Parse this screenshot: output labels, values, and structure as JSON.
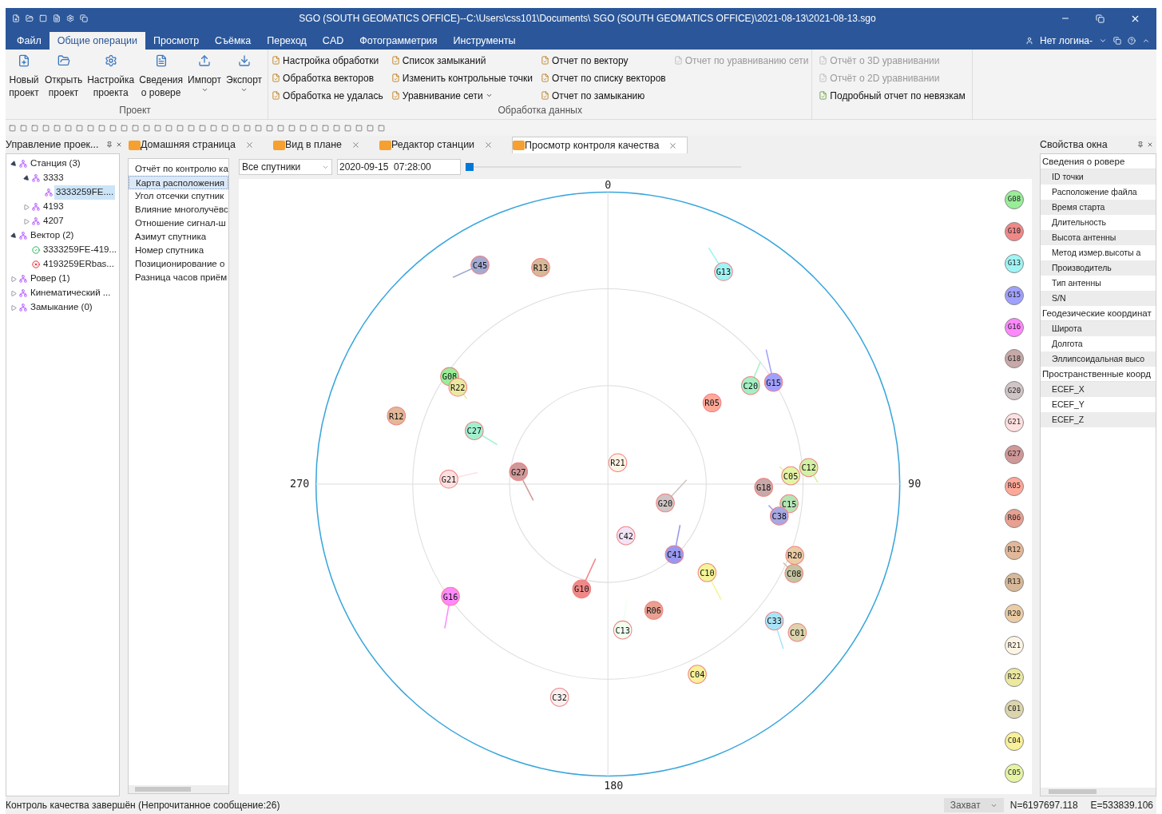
{
  "window": {
    "title": "SGO (SOUTH GEOMATICS OFFICE)--C:\\Users\\css101\\Documents\\ SGO (SOUTH GEOMATICS OFFICE)\\2021-08-13\\2021-08-13.sgo"
  },
  "menu": [
    {
      "label": "Файл",
      "selected": false
    },
    {
      "label": "Общие операции",
      "selected": true
    },
    {
      "label": "Просмотр",
      "selected": false
    },
    {
      "label": "Съёмка",
      "selected": false
    },
    {
      "label": "Переход",
      "selected": false
    },
    {
      "label": "CAD",
      "selected": false
    },
    {
      "label": "Фотограмметрия",
      "selected": false
    },
    {
      "label": "Инструменты",
      "selected": false
    }
  ],
  "user": "Нет логина-",
  "ribbon": {
    "project_group": {
      "caption": "Проект",
      "buttons": [
        {
          "kind": "new",
          "label": "Новый проект",
          "dropdown": false
        },
        {
          "kind": "open",
          "label": "Открыть проект",
          "dropdown": false
        },
        {
          "kind": "settings",
          "label": "Настройка проекта",
          "dropdown": false
        },
        {
          "kind": "info",
          "label": "Сведения о ровере",
          "dropdown": false
        },
        {
          "kind": "import",
          "label": "Импорт",
          "dropdown": true
        },
        {
          "kind": "export",
          "label": "Экспорт",
          "dropdown": true
        }
      ]
    },
    "data_group": {
      "caption": "Обработка данных",
      "columns": [
        [
          {
            "label": "Настройка обработки",
            "disabled": false,
            "dropdown": false
          },
          {
            "label": "Обработка векторов",
            "disabled": false,
            "dropdown": false
          },
          {
            "label": "Обработка не удалась",
            "disabled": false,
            "dropdown": false
          }
        ],
        [
          {
            "label": "Список замыканий",
            "disabled": false,
            "dropdown": false
          },
          {
            "label": "Изменить контрольные точки",
            "disabled": false,
            "dropdown": false
          },
          {
            "label": "Уравнивание сети",
            "disabled": false,
            "dropdown": true
          }
        ],
        [
          {
            "label": "Отчет по вектору",
            "disabled": false,
            "dropdown": false
          },
          {
            "label": "Отчет по списку векторов",
            "disabled": false,
            "dropdown": false
          },
          {
            "label": "Отчет по замыканию",
            "disabled": false,
            "dropdown": false
          }
        ],
        [
          {
            "label": "Отчет по уравниванию сети",
            "disabled": true,
            "dropdown": false
          }
        ]
      ]
    },
    "report_group": {
      "items": [
        {
          "label": "Отчёт о 3D уравнивании",
          "disabled": true
        },
        {
          "label": "Отчёт о 2D уравнивании",
          "disabled": true
        },
        {
          "label": "Подробный отчет по невязкам",
          "disabled": false
        }
      ]
    }
  },
  "left_panel": {
    "title": "Управление проек...",
    "tree": [
      {
        "label": "Станция (3)",
        "selected": false,
        "expanded": true,
        "children": [
          {
            "label": "3333",
            "selected": false,
            "expanded": true,
            "children": [
              {
                "label": "3333259FE....",
                "selected": true
              }
            ]
          },
          {
            "label": "4193",
            "selected": false,
            "expanded": false
          },
          {
            "label": "4207",
            "selected": false,
            "expanded": false
          }
        ]
      },
      {
        "label": "Вектор (2)",
        "selected": false,
        "expanded": true,
        "children": [
          {
            "label": "3333259FE-419...",
            "selected": false,
            "kind": "ok"
          },
          {
            "label": "4193259ERbas...",
            "selected": false,
            "kind": "failed"
          }
        ]
      },
      {
        "label": "Ровер (1)",
        "selected": false,
        "expanded": false
      },
      {
        "label": "Кинематический ...",
        "selected": false,
        "expanded": false
      },
      {
        "label": "Замыкание (0)",
        "selected": false,
        "expanded": false
      }
    ]
  },
  "doc_tabs": [
    {
      "label": "Домашняя страница",
      "selected": false
    },
    {
      "label": "Вид в плане",
      "selected": false
    },
    {
      "label": "Редактор станции",
      "selected": false
    },
    {
      "label": "Просмотр контроля качества",
      "selected": true
    }
  ],
  "qc_list": [
    {
      "label": "Отчёт по контролю ка",
      "selected": false
    },
    {
      "label": "Карта расположения",
      "selected": true
    },
    {
      "label": "Угол отсечки спутник",
      "selected": false
    },
    {
      "label": "Влияние многолучёвс",
      "selected": false
    },
    {
      "label": "Отношение сигнал-ш",
      "selected": false
    },
    {
      "label": "Азимут спутника",
      "selected": false
    },
    {
      "label": "Номер спутника",
      "selected": false
    },
    {
      "label": "Позиционирование о",
      "selected": false
    },
    {
      "label": "Разница часов приём",
      "selected": false
    }
  ],
  "plot": {
    "filter": "Все спутники",
    "time": "2020-09-15  07:28:00",
    "slider": {
      "level": 0
    },
    "axis_labels": [
      "0",
      "90",
      "180",
      "270"
    ],
    "satellites": [
      {
        "label": "C45",
        "color": "#a3aad2"
      },
      {
        "label": "R13",
        "color": "#d8b898"
      },
      {
        "label": "G13",
        "color": "#a0f4f4"
      },
      {
        "label": "G08",
        "color": "#98ee98"
      },
      {
        "label": "R22",
        "color": "#ece8a0"
      },
      {
        "label": "C20",
        "color": "#a4f0c4"
      },
      {
        "label": "G15",
        "color": "#a0a0ff"
      },
      {
        "label": "R05",
        "color": "#ffa898"
      },
      {
        "label": "R12",
        "color": "#e2b898"
      },
      {
        "label": "C27",
        "color": "#a0f0d0"
      },
      {
        "label": "R21",
        "color": "#fff4e4"
      },
      {
        "label": "C12",
        "color": "#d4f0a4"
      },
      {
        "label": "G27",
        "color": "#d09898"
      },
      {
        "label": "C05",
        "color": "#e4f4a4"
      },
      {
        "label": "G21",
        "color": "#ffe0e0"
      },
      {
        "label": "G18",
        "color": "#c8a8a8"
      },
      {
        "label": "G20",
        "color": "#d0c4c4"
      },
      {
        "label": "C15",
        "color": "#b4e4b4"
      },
      {
        "label": "C38",
        "color": "#a8a8e4"
      },
      {
        "label": "C42",
        "color": "#f2e4f4"
      },
      {
        "label": "C41",
        "color": "#9898f0"
      },
      {
        "label": "R20",
        "color": "#eccca4"
      },
      {
        "label": "C10",
        "color": "#f4f498"
      },
      {
        "label": "C08",
        "color": "#c4c4a0"
      },
      {
        "label": "G10",
        "color": "#f08888"
      },
      {
        "label": "G16",
        "color": "#ff88ff"
      },
      {
        "label": "R06",
        "color": "#e8a090"
      },
      {
        "label": "C33",
        "color": "#a8e4f8"
      },
      {
        "label": "C13",
        "color": "#f0fff0"
      },
      {
        "label": "C01",
        "color": "#dcd4ac"
      },
      {
        "label": "C04",
        "color": "#f8f09a"
      },
      {
        "label": "C32",
        "color": "#fbf0f0"
      }
    ],
    "legend": [
      {
        "label": "G08",
        "color": "#98ee98"
      },
      {
        "label": "G10",
        "color": "#f08888"
      },
      {
        "label": "G13",
        "color": "#a0f4f4"
      },
      {
        "label": "G15",
        "color": "#a0a0ff"
      },
      {
        "label": "G16",
        "color": "#ff88ff"
      },
      {
        "label": "G18",
        "color": "#c8a8a8"
      },
      {
        "label": "G20",
        "color": "#d0c4c4"
      },
      {
        "label": "G21",
        "color": "#ffe0e0"
      },
      {
        "label": "G27",
        "color": "#d09898"
      },
      {
        "label": "R05",
        "color": "#ffa898"
      },
      {
        "label": "R06",
        "color": "#e8a090"
      },
      {
        "label": "R12",
        "color": "#e2b898"
      },
      {
        "label": "R13",
        "color": "#d8b898"
      },
      {
        "label": "R20",
        "color": "#eccca4"
      },
      {
        "label": "R21",
        "color": "#fff4e4"
      },
      {
        "label": "R22",
        "color": "#ece8a0"
      },
      {
        "label": "C01",
        "color": "#dcd4ac"
      },
      {
        "label": "C04",
        "color": "#f8f09a"
      },
      {
        "label": "C05",
        "color": "#e4f4a4"
      }
    ]
  },
  "properties": {
    "title": "Свойства окна",
    "groups": [
      {
        "label": "Сведения о ровере",
        "rows": [
          "ID точки",
          "Расположение файла",
          "Время старта",
          "Длительность",
          "Высота антенны",
          "Метод измер.высоты а",
          "Производитель",
          "Тип антенны",
          "S/N"
        ]
      },
      {
        "label": "Геодезические координат",
        "rows": [
          "Широта",
          "Долгота",
          "Эллипсоидальная высо"
        ]
      },
      {
        "label": "Пространственные коорд",
        "rows": [
          "ECEF_X",
          "ECEF_Y",
          "ECEF_Z"
        ]
      }
    ]
  },
  "status_bar": {
    "message": "Контроль качества завершён (Непрочитанное сообщение:26)",
    "snap": "Захват",
    "north": "N=6197697.118",
    "east": "E=533839.106"
  }
}
